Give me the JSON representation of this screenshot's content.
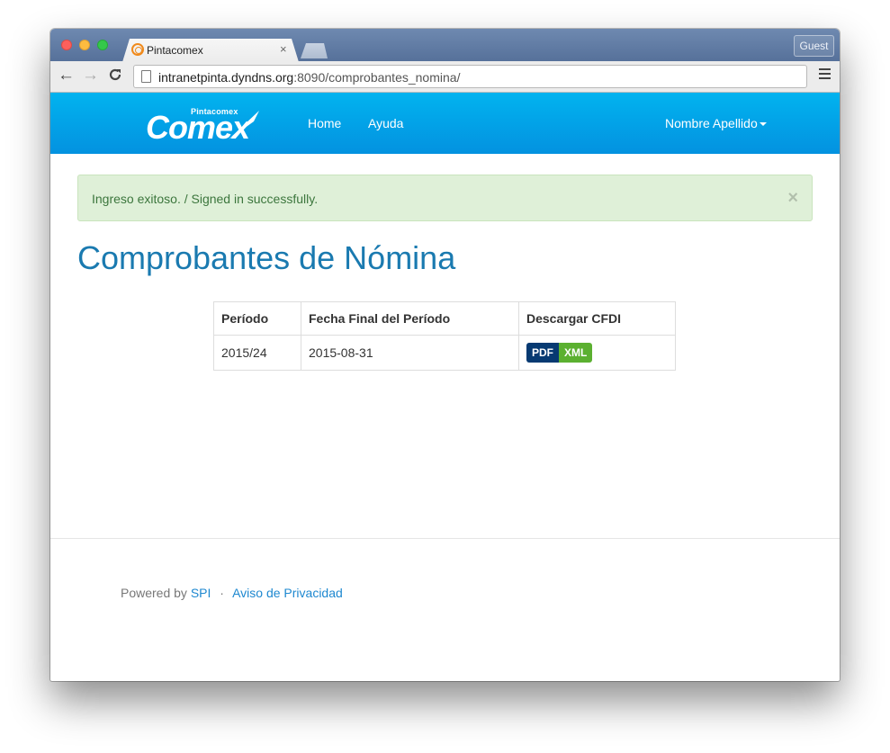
{
  "browser": {
    "tab_title": "Pintacomex",
    "tab_close": "×",
    "profile_label": "Guest",
    "url_host": "intranetpinta.dyndns.org",
    "url_rest": ":8090/comprobantes_nomina/",
    "back_glyph": "←",
    "forward_glyph": "→",
    "reload_glyph": "C"
  },
  "navbar": {
    "logo_small": "Pintacomex",
    "logo_big": "Comex",
    "links": [
      "Home",
      "Ayuda"
    ],
    "user_menu": "Nombre Apellido",
    "background": "#0aa3ea"
  },
  "alert": {
    "text": "Ingreso exitoso. / Signed in successfully.",
    "close": "×",
    "color": "#3c763d"
  },
  "page": {
    "title": "Comprobantes de Nómina",
    "title_color": "#1a7ab0"
  },
  "table": {
    "headers": [
      "Período",
      "Fecha Final del Período",
      "Descargar CFDI"
    ],
    "rows": [
      {
        "periodo": "2015/24",
        "fecha": "2015-08-31",
        "pdf": "PDF",
        "xml": "XML"
      }
    ]
  },
  "footer": {
    "powered_by": "Powered by",
    "spi_link": "SPI",
    "separator": "·",
    "privacy_link": "Aviso de Privacidad"
  }
}
